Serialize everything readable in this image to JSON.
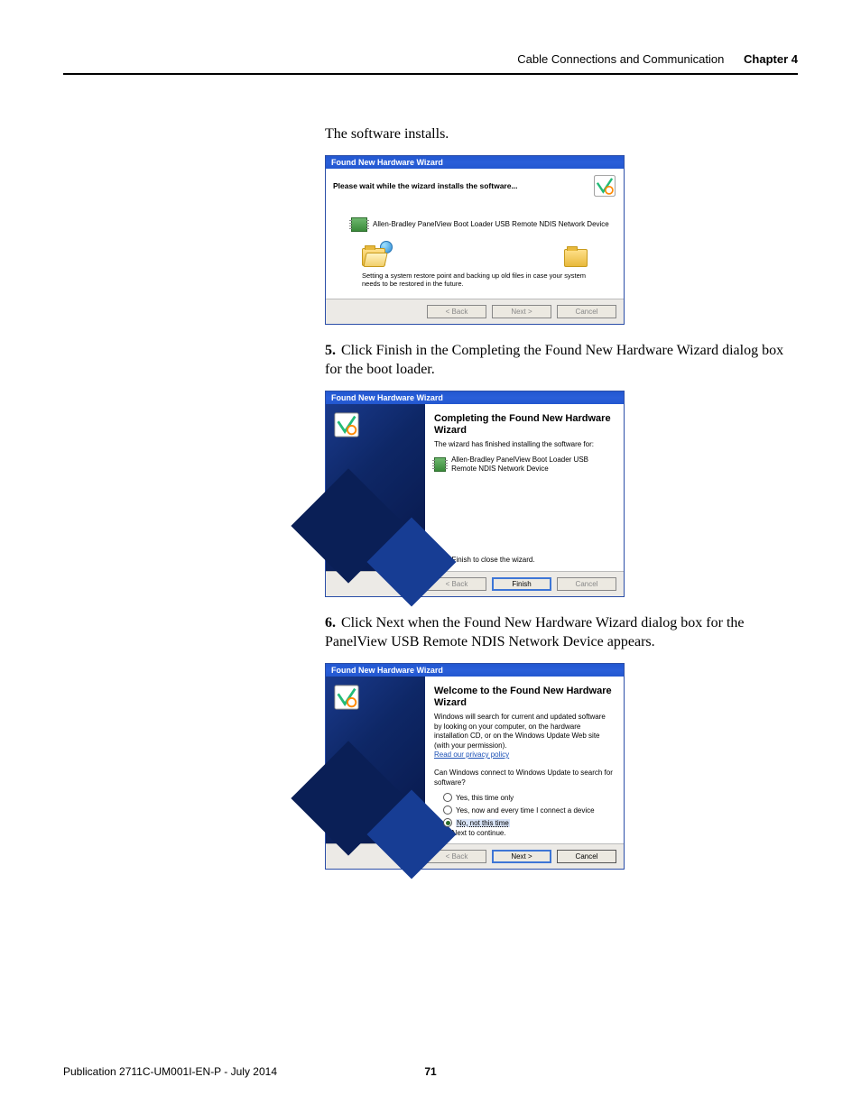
{
  "header": {
    "section_title": "Cable Connections and Communication",
    "chapter_label": "Chapter 4"
  },
  "intro_line": "The software installs.",
  "step5": {
    "num": "5.",
    "text": "Click Finish in the Completing the Found New Hardware Wizard dialog box for the boot loader."
  },
  "step6": {
    "num": "6.",
    "text": "Click Next when the Found New Hardware Wizard dialog box for the PanelView USB Remote NDIS Network Device appears."
  },
  "wiz_common": {
    "title": "Found New Hardware Wizard",
    "btn_back": "< Back",
    "btn_next": "Next >",
    "btn_finish": "Finish",
    "btn_cancel": "Cancel"
  },
  "wiz1": {
    "status_heading": "Please wait while the wizard installs the software...",
    "device_label": "Allen-Bradley PanelView Boot Loader USB Remote NDIS Network Device",
    "status_detail": "Setting a system restore point and backing up old files in case your system needs to be restored in the future."
  },
  "wiz2": {
    "heading": "Completing the Found New Hardware Wizard",
    "subline": "The wizard has finished installing the software for:",
    "device_label": "Allen-Bradley PanelView Boot Loader USB Remote NDIS Network Device",
    "close_line": "Click Finish to close the wizard."
  },
  "wiz3": {
    "heading": "Welcome to the Found New Hardware Wizard",
    "body1": "Windows will search for current and updated software by looking on your computer, on the hardware installation CD, or on the Windows Update Web site (with your permission).",
    "privacy_link": "Read our privacy policy",
    "question": "Can Windows connect to Windows Update to search for software?",
    "opt1": "Yes, this time only",
    "opt2": "Yes, now and every time I connect a device",
    "opt3": "No, not this time",
    "continue_line": "Click Next to continue."
  },
  "footer": {
    "pub": "Publication 2711C-UM001I-EN-P - July 2014",
    "page": "71"
  }
}
